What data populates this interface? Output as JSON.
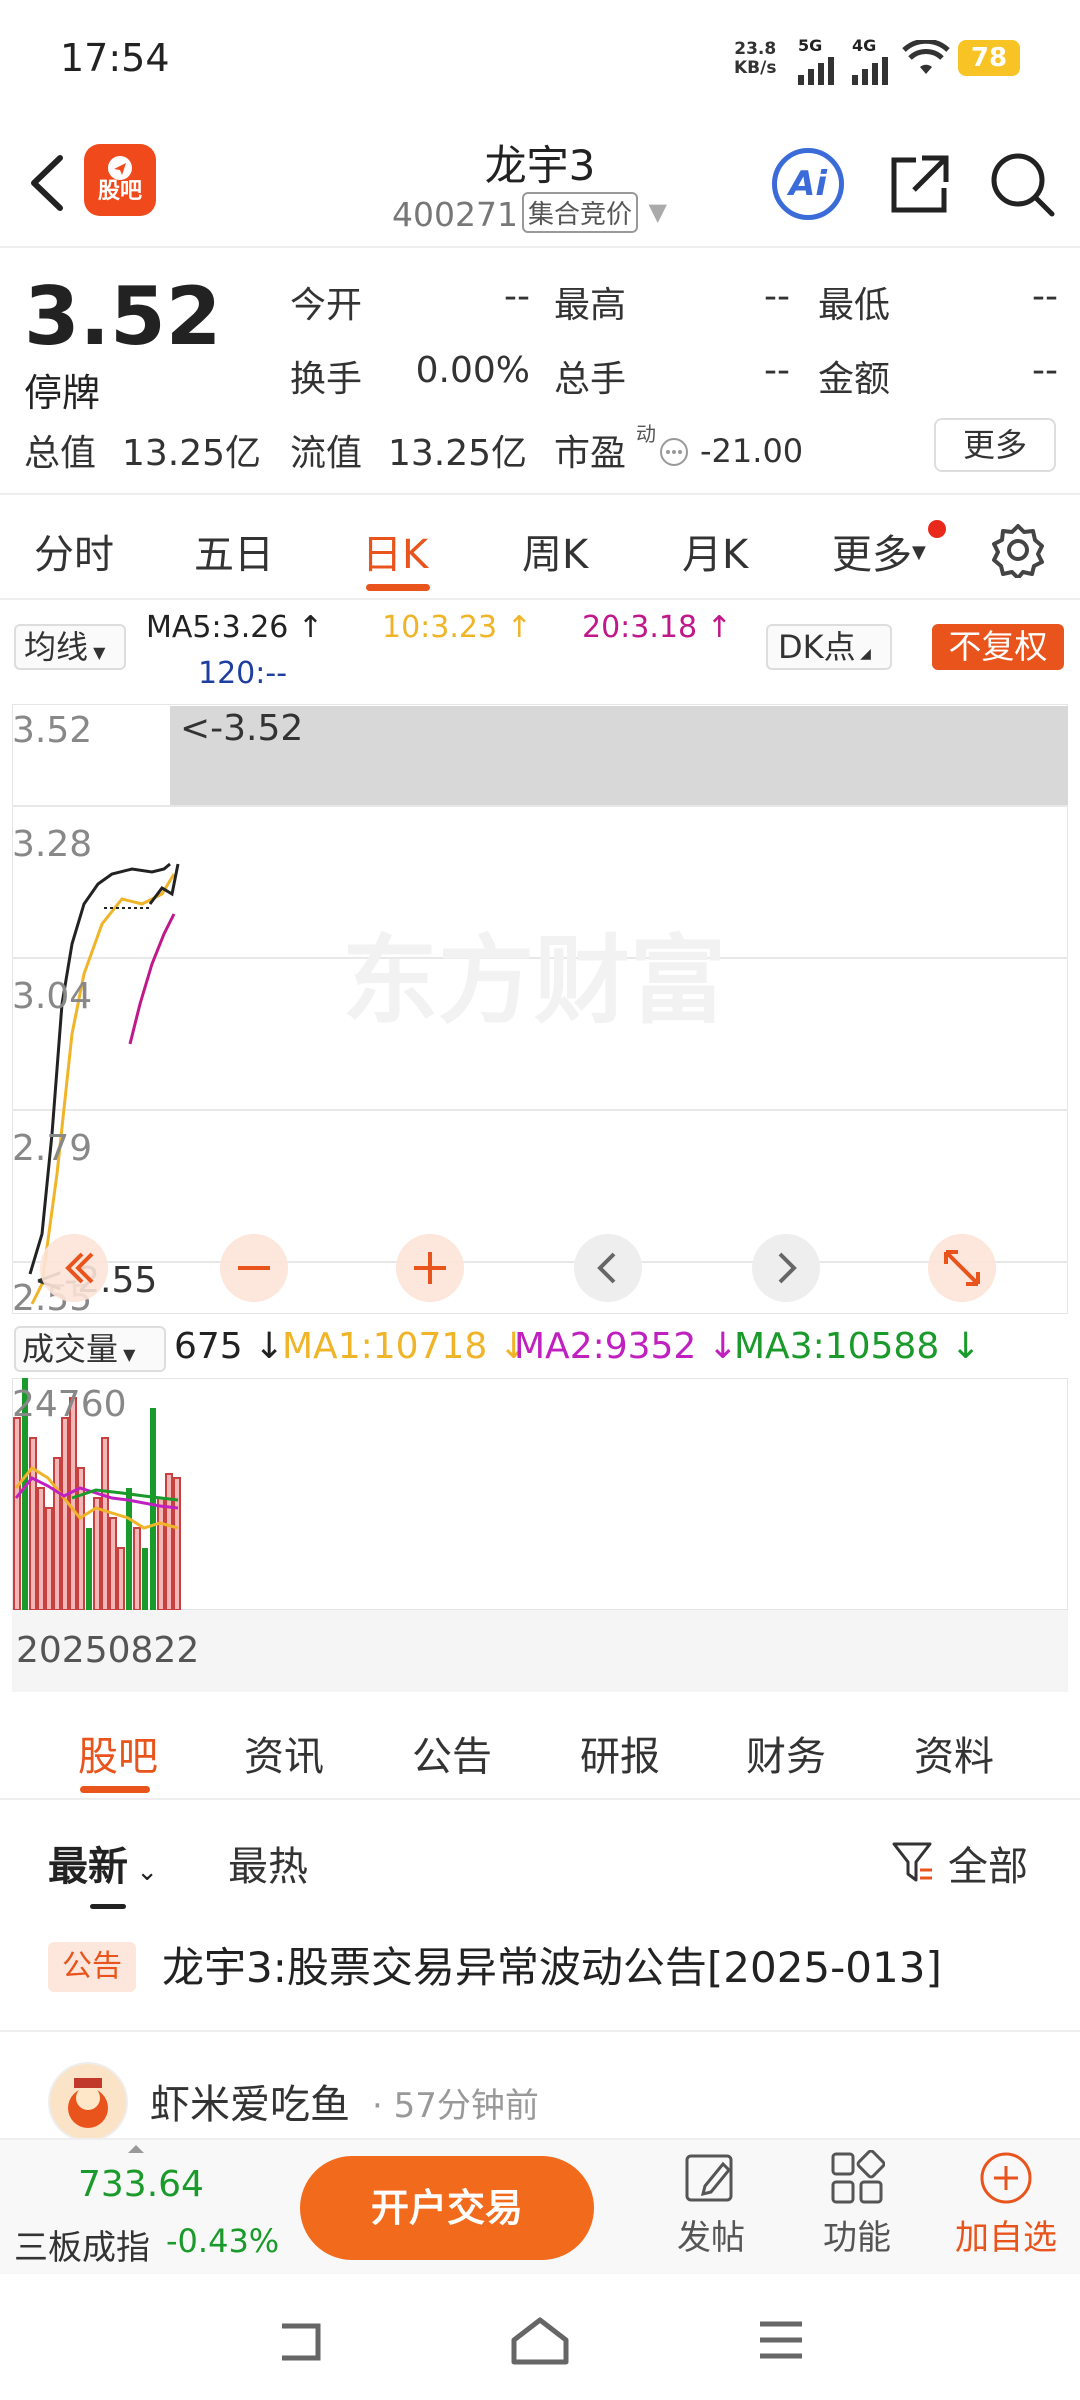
{
  "status": {
    "time": "17:54",
    "net_speed": "23.8",
    "net_unit": "KB/s",
    "sig1": "5G",
    "sig2": "4G",
    "battery": "78"
  },
  "header": {
    "logo_text": "股吧",
    "title": "龙宇3",
    "code": "400271",
    "auction_badge": "集合竞价",
    "ai_label": "Ai"
  },
  "quote": {
    "price": "3.52",
    "status": "停牌",
    "open_label": "今开",
    "open_value": "--",
    "high_label": "最高",
    "high_value": "--",
    "low_label": "最低",
    "low_value": "--",
    "turnover_label": "换手",
    "turnover_value": "0.00%",
    "volume_label": "总手",
    "volume_value": "--",
    "amount_label": "金额",
    "amount_value": "--",
    "mktcap_label": "总值",
    "mktcap_value": "13.25亿",
    "float_label": "流值",
    "float_value": "13.25亿",
    "pe_label": "市盈",
    "pe_sup": "动",
    "pe_value": "-21.00",
    "more_label": "更多"
  },
  "ktabs": [
    "分时",
    "五日",
    "日K",
    "周K",
    "月K",
    "更多"
  ],
  "ma": {
    "btn": "均线",
    "ma5": "MA5:3.26 ↑",
    "ma10": "10:3.23 ↑",
    "ma20": "20:3.18 ↑",
    "ma120": "120:--",
    "dk": "DK点",
    "fq": "不复权"
  },
  "chart": {
    "y_labels": [
      "3.52",
      "3.28",
      "3.04",
      "2.79",
      "2.55"
    ],
    "max_label": "<-3.52",
    "min_label": "<-2.55",
    "watermark": "东方财富",
    "colors": {
      "k": "#222222",
      "ma5": "#222222",
      "ma10": "#f0b429",
      "ma20": "#c0188a"
    }
  },
  "volume": {
    "btn": "成交量",
    "val": "675 ↓",
    "ma1": "MA1:10718 ↓",
    "ma2": "MA2:9352 ↓",
    "ma3": "MA3:10588 ↓",
    "max_label": "24760",
    "date": "20250822"
  },
  "subtabs": [
    "股吧",
    "资讯",
    "公告",
    "研报",
    "财务",
    "资料"
  ],
  "filters": {
    "latest": "最新",
    "hot": "最热",
    "all": "全部"
  },
  "notice": {
    "tag": "公告",
    "text": "龙宇3:股票交易异常波动公告[2025-013]"
  },
  "post": {
    "user": "虾米爱吃鱼",
    "time": "· 57分钟前"
  },
  "bottom": {
    "index_value": "733.64",
    "index_name": "三板成指",
    "index_change": "-0.43%",
    "trade_btn": "开户交易",
    "post_label": "发帖",
    "func_label": "功能",
    "add_label": "加自选"
  }
}
